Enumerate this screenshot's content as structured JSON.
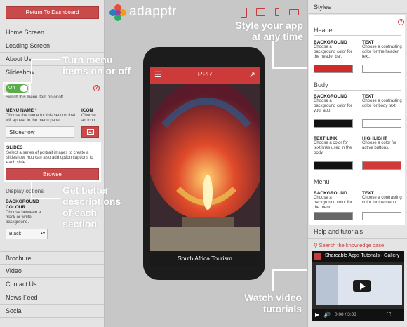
{
  "sidebar": {
    "dashboard_button": "Return To Dashboard",
    "items_top": [
      "Home Screen",
      "Loading Screen",
      "About Us",
      "Slideshow"
    ],
    "toggle_label": "On",
    "toggle_hint": "Switch this menu item on or off",
    "menu_name_label": "MENU NAME *",
    "menu_name_hint": "Choose the name for this section that will appear in the menu panel.",
    "menu_name_value": "Slideshow",
    "icon_label": "ICON",
    "icon_hint": "Choose an icon.",
    "slides_label": "SLIDES",
    "slides_hint": "Select a series of portrait images to create a slideshow. You can also add option captions to each slide.",
    "browse_button": "Browse",
    "display_options": "Display options",
    "bg_colour_label": "BACKGROUND COLOUR",
    "bg_colour_hint": "Choose between a black or white background.",
    "bg_colour_value": "Black",
    "items_bottom": [
      "Brochure",
      "Video",
      "Contact Us",
      "News Feed",
      "Social"
    ]
  },
  "brand": {
    "name": "adapptr"
  },
  "phone": {
    "title": "PPR",
    "caption": "South Africa Tourism"
  },
  "callouts": {
    "menu": "Turn menu items on or off",
    "descriptions": "Get better descriptions of each section",
    "style": "Style your app at any time",
    "video": "Watch video tutorials"
  },
  "styles": {
    "title": "Styles",
    "header": {
      "title": "Header",
      "bg_label": "BACKGROUND",
      "bg_hint": "Choose a background color for the header bar.",
      "text_label": "TEXT",
      "text_hint": "Choose a contrasting color for the header text."
    },
    "body": {
      "title": "Body",
      "bg_label": "BACKGROUND",
      "bg_hint": "Choose a background color for your app.",
      "text_label": "TEXT",
      "text_hint": "Choose a contrasting color for body text.",
      "link_label": "TEXT LINK",
      "link_hint": "Choose a color for text links used in the body.",
      "highlight_label": "HIGHLIGHT",
      "highlight_hint": "Choose a color for active buttons."
    },
    "menu": {
      "title": "Menu",
      "bg_label": "BACKGROUND",
      "bg_hint": "Choose a background color for the menu.",
      "text_label": "TEXT",
      "text_hint": "Choose a contrasting color for the menu."
    }
  },
  "help": {
    "title": "Help and tutorials",
    "search_link": "Search the knowledge base",
    "video_title": "Shareable Apps Tutorials - Gallery",
    "video_time": "0:00 / 3:03"
  },
  "colors": {
    "accent": "#cc3a3a",
    "bar": "#c94a4a",
    "toggle": "#5aad4a"
  }
}
